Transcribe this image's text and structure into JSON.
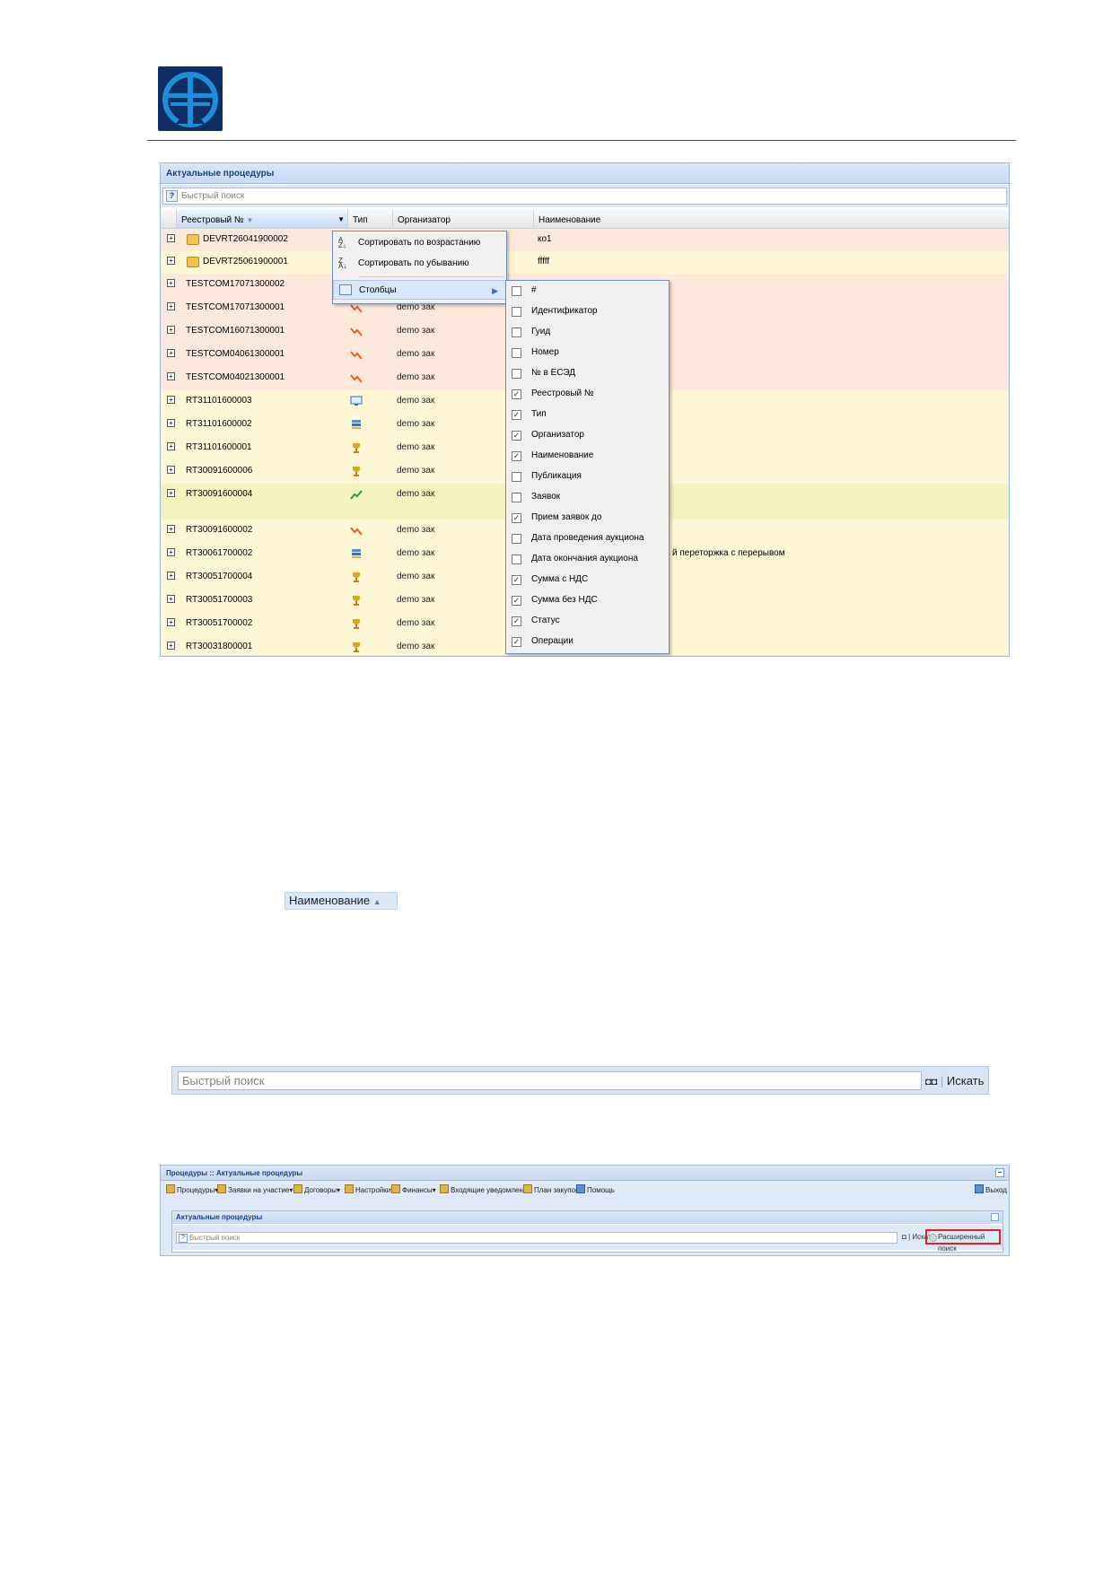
{
  "brand": {
    "logo": "company-logo-emblem"
  },
  "panel": {
    "title": "Актуальные процедуры",
    "quick_search_placeholder": "Быстрый поиск",
    "columns": [
      "Реестровый №",
      "Тип",
      "Организатор",
      "Наименование"
    ],
    "rows": [
      {
        "num": "DEVRT26041900002",
        "locked": true,
        "type_icon": "lock-icon",
        "org": "",
        "name": "ко1"
      },
      {
        "num": "DEVRT25061900001",
        "locked": true,
        "type_icon": "lock-icon",
        "org": "",
        "name": "fffff"
      },
      {
        "num": "TESTCOM17071300002",
        "locked": false,
        "type_icon": "",
        "org": "",
        "name": ""
      },
      {
        "num": "TESTCOM17071300001",
        "locked": false,
        "type_icon": "auction-down-icon",
        "org": "demo зак",
        "name": ""
      },
      {
        "num": "TESTCOM16071300001",
        "locked": false,
        "type_icon": "auction-down-icon",
        "org": "demo зак",
        "name": ""
      },
      {
        "num": "TESTCOM04061300001",
        "locked": false,
        "type_icon": "auction-down-icon",
        "org": "demo зак",
        "name": ""
      },
      {
        "num": "TESTCOM04021300001",
        "locked": false,
        "type_icon": "auction-down-icon",
        "org": "demo зак",
        "name": ""
      },
      {
        "num": "RT31101600003",
        "locked": false,
        "type_icon": "monitor-icon",
        "org": "demo зак",
        "name": ""
      },
      {
        "num": "RT31101600002",
        "locked": false,
        "type_icon": "stack-icon",
        "org": "demo зак",
        "name": ""
      },
      {
        "num": "RT31101600001",
        "locked": false,
        "type_icon": "trophy-icon",
        "org": "demo зак",
        "name": ""
      },
      {
        "num": "RT30091600006",
        "locked": false,
        "type_icon": "trophy-icon",
        "org": "demo зак",
        "name": ""
      },
      {
        "num": "RT30091600004",
        "locked": false,
        "type_icon": "auction-up-icon",
        "org": "demo зак",
        "name": ""
      },
      {
        "num": "RT30091600002",
        "locked": false,
        "type_icon": "auction-down-icon",
        "org": "demo зак",
        "name": ""
      },
      {
        "num": "RT30061700002",
        "locked": false,
        "type_icon": "stack-icon",
        "org": "demo зак",
        "name": "й переторжка с перерывом"
      },
      {
        "num": "RT30051700004",
        "locked": false,
        "type_icon": "trophy-icon",
        "org": "demo зак",
        "name": ""
      },
      {
        "num": "RT30051700003",
        "locked": false,
        "type_icon": "trophy-icon",
        "org": "demo зак",
        "name": ""
      },
      {
        "num": "RT30051700002",
        "locked": false,
        "type_icon": "trophy-icon",
        "org": "demo зак",
        "name": ""
      },
      {
        "num": "RT30031800001",
        "locked": false,
        "type_icon": "trophy-icon",
        "org": "demo зак",
        "name": ""
      }
    ]
  },
  "context_menu": {
    "sort_asc": "Сортировать по возрастанию",
    "sort_desc": "Сортировать по убыванию",
    "columns": "Столбцы"
  },
  "columns_menu": [
    {
      "label": "#",
      "checked": false
    },
    {
      "label": "Идентификатор",
      "checked": false
    },
    {
      "label": "Гуид",
      "checked": false
    },
    {
      "label": "Номер",
      "checked": false
    },
    {
      "label": "№ в ЕСЭД",
      "checked": false
    },
    {
      "label": "Реестровый №",
      "checked": true
    },
    {
      "label": "Тип",
      "checked": true
    },
    {
      "label": "Организатор",
      "checked": true
    },
    {
      "label": "Наименование",
      "checked": true
    },
    {
      "label": "Публикация",
      "checked": false
    },
    {
      "label": "Заявок",
      "checked": false
    },
    {
      "label": "Прием заявок до",
      "checked": true
    },
    {
      "label": "Дата проведения аукциона",
      "checked": false
    },
    {
      "label": "Дата окончания аукциона",
      "checked": false
    },
    {
      "label": "Сумма с НДС",
      "checked": true
    },
    {
      "label": "Сумма без НДС",
      "checked": true
    },
    {
      "label": "Статус",
      "checked": true
    },
    {
      "label": "Операции",
      "checked": true
    }
  ],
  "sort_label": "Наименование",
  "search_bar": {
    "placeholder": "Быстрый поиск",
    "button": "Искать"
  },
  "panel3": {
    "title": "Процедуры :: Актуальные процедуры",
    "toolbar": [
      "Процедуры",
      "Заявки на участие",
      "Договоры",
      "Настройки",
      "Финансы",
      "Входящие уведомления",
      "План закупок",
      "Помощь"
    ],
    "logout": "Выход",
    "inner_title": "Актуальные процедуры",
    "search_placeholder": "Быстрый поиск",
    "search_button": "Искать",
    "advanced_search": "Расширенный поиск"
  },
  "colors": {
    "row_a": "#fde9dc",
    "row_b": "#fdf7d6",
    "row_hl": "#f4f3c0",
    "accent": "#15428b",
    "highlight_border": "#e0202d"
  }
}
